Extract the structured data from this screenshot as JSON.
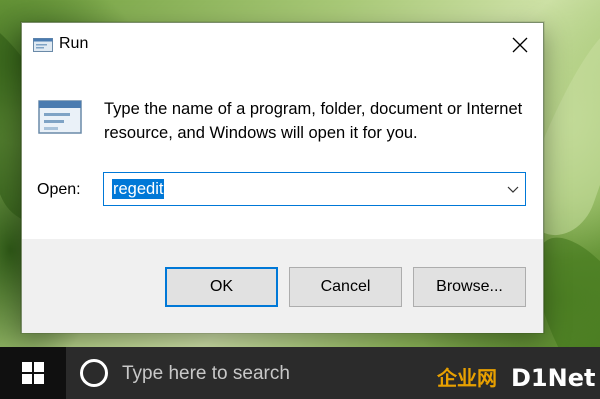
{
  "dialog": {
    "title": "Run",
    "description": "Type the name of a program, folder, document or Internet resource, and Windows will open it for you.",
    "open_label": "Open:",
    "open_value": "regedit",
    "buttons": {
      "ok": "OK",
      "cancel": "Cancel",
      "browse": "Browse..."
    }
  },
  "taskbar": {
    "search_placeholder": "Type here to search"
  },
  "watermark": {
    "cn": "企业网",
    "d1net": "D1Net"
  },
  "icons": [
    "run-icon",
    "close-icon",
    "chevron-down-icon",
    "windows-logo-icon",
    "cortana-icon"
  ],
  "colors": {
    "accent": "#0078d7",
    "taskbar": "#101010",
    "search": "#2b2b2b",
    "dialog_footer": "#f0f0f0"
  }
}
